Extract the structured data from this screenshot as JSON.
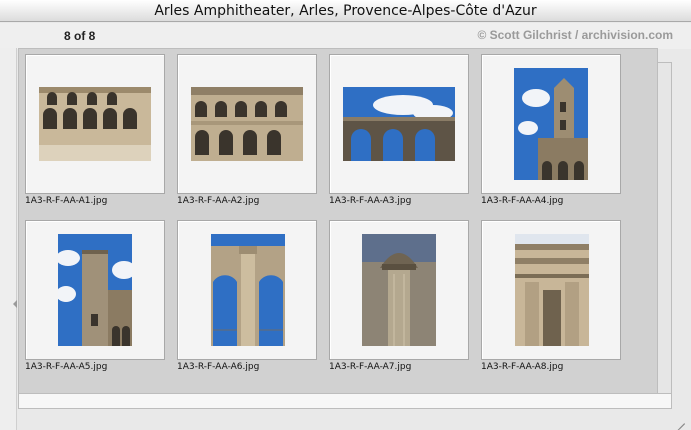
{
  "window": {
    "title": "Arles Amphitheater, Arles, Provence-Alpes-Côte d'Azur",
    "count": "8 of 8",
    "credit": "© Scott Gilchrist / archivision.com"
  },
  "thumbnails": [
    {
      "filename": "1A3-R-F-AA-A1.jpg",
      "orientation": "landscape",
      "scene": "amphitheater-arcade-facade-with-plaza"
    },
    {
      "filename": "1A3-R-F-AA-A2.jpg",
      "orientation": "landscape",
      "scene": "amphitheater-arcade-facade-front"
    },
    {
      "filename": "1A3-R-F-AA-A3.jpg",
      "orientation": "landscape",
      "scene": "arches-against-cloudy-sky"
    },
    {
      "filename": "1A3-R-F-AA-A4.jpg",
      "orientation": "portrait",
      "scene": "tower-and-arcade-blue-sky"
    },
    {
      "filename": "1A3-R-F-AA-A5.jpg",
      "orientation": "portrait",
      "scene": "medieval-tower-with-clouds"
    },
    {
      "filename": "1A3-R-F-AA-A6.jpg",
      "orientation": "portrait",
      "scene": "arch-with-column-closeup"
    },
    {
      "filename": "1A3-R-F-AA-A7.jpg",
      "orientation": "portrait",
      "scene": "corinthian-capital-column"
    },
    {
      "filename": "1A3-R-F-AA-A8.jpg",
      "orientation": "portrait",
      "scene": "entablature-detail"
    }
  ],
  "colors": {
    "sky": "#2f6fc4",
    "stone": "#c9b89a",
    "shadow": "#3a342c",
    "cloud": "#f2f4f8"
  }
}
